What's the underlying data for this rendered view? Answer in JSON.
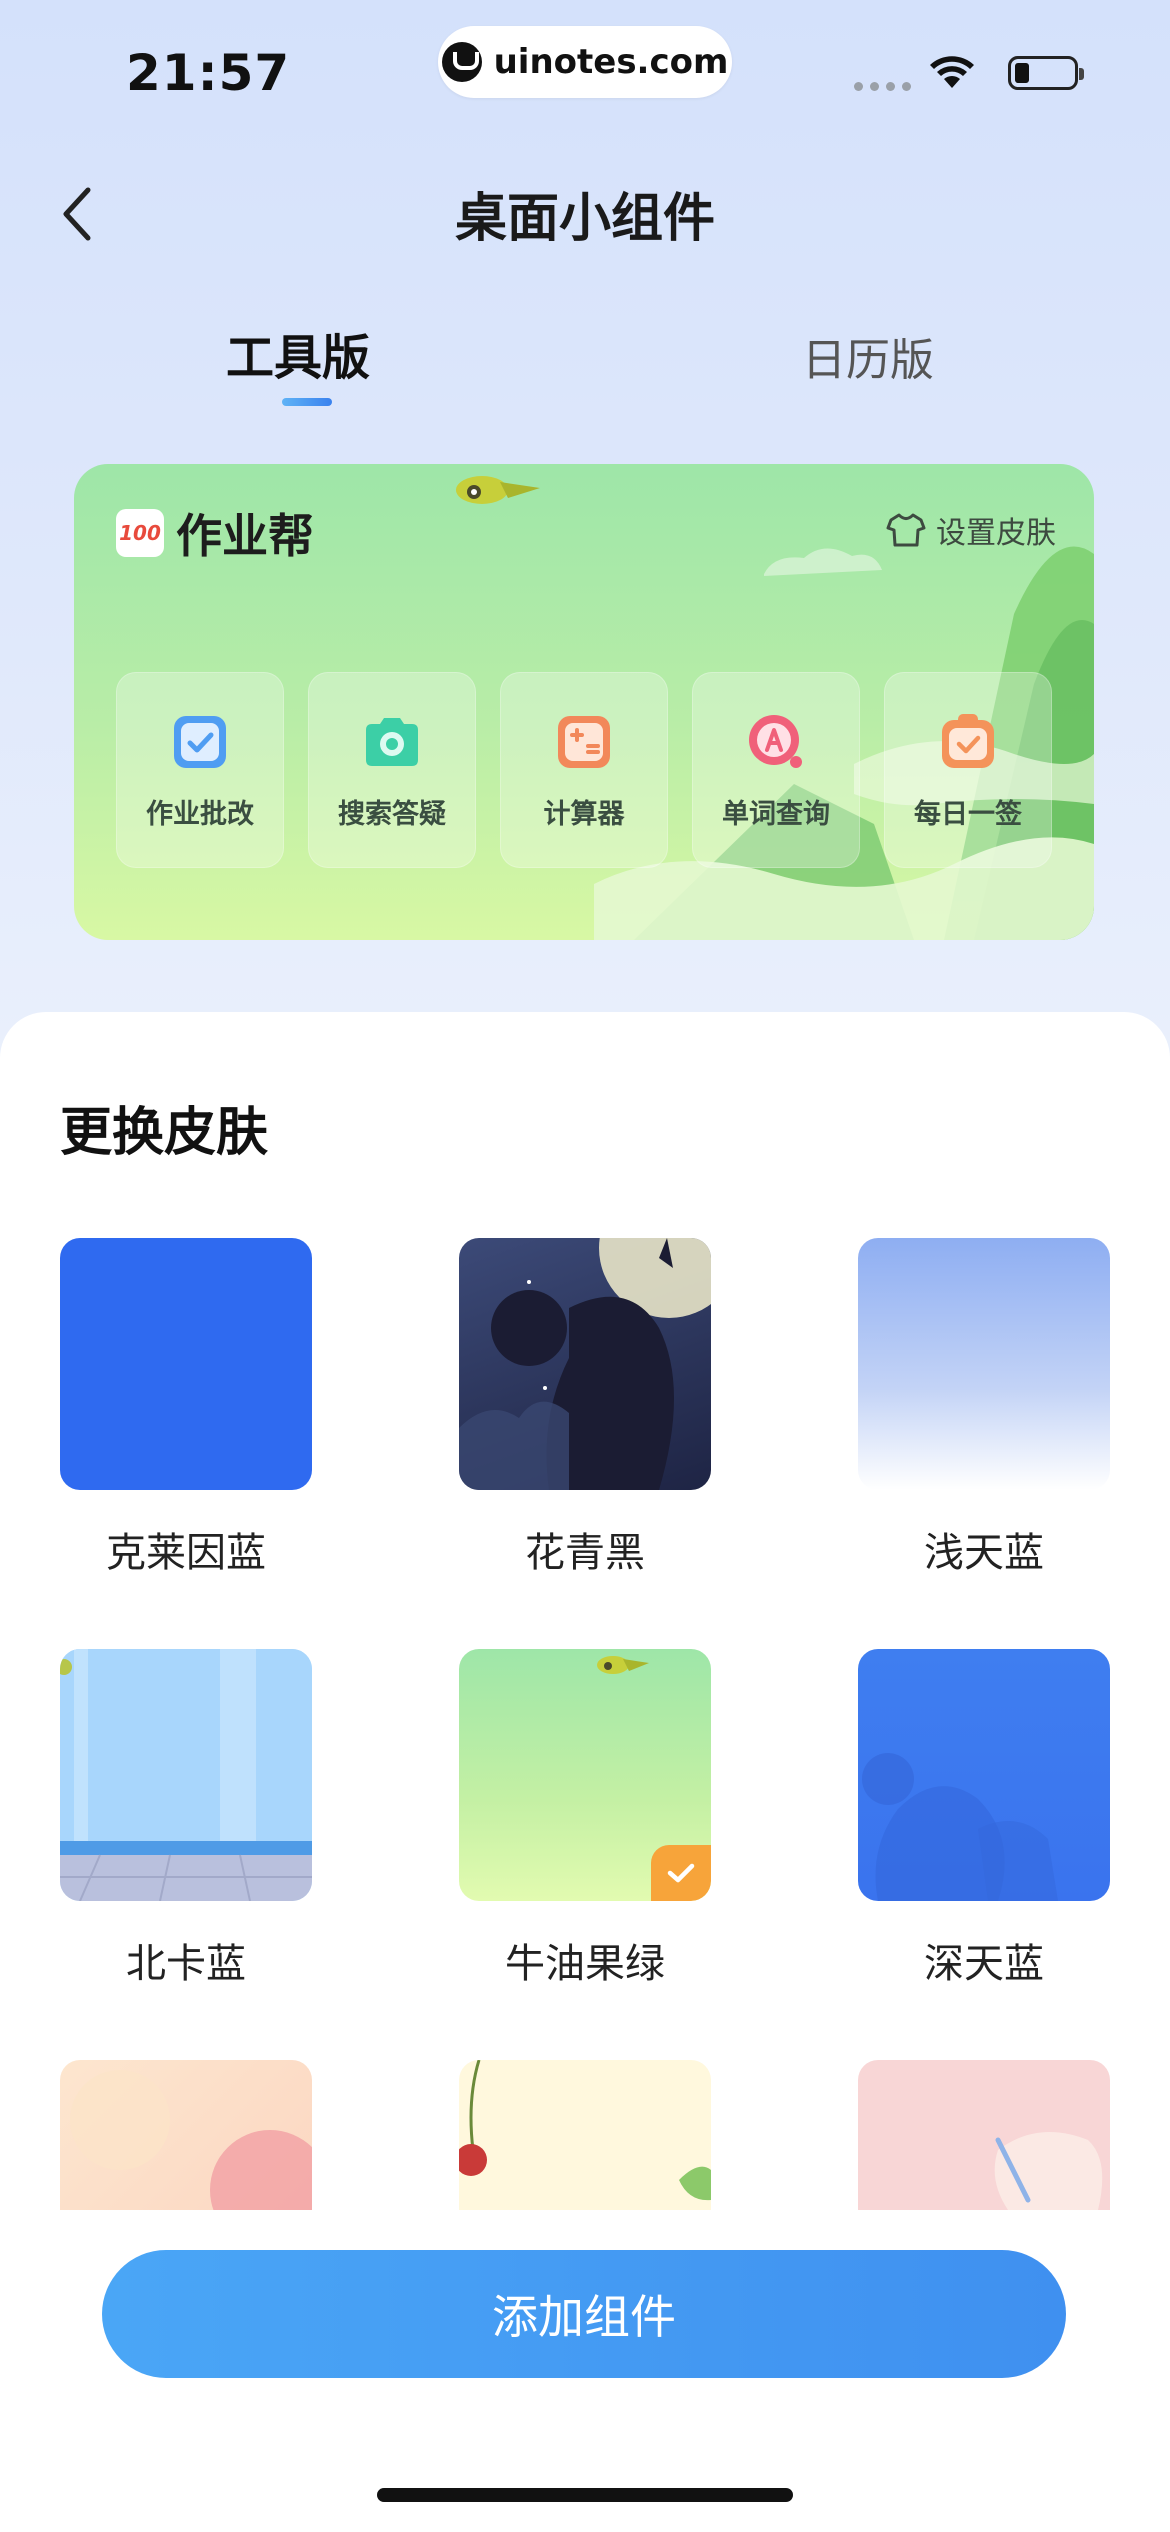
{
  "status_bar": {
    "time": "21:57",
    "url": "uinotes.com"
  },
  "nav": {
    "title": "桌面小组件",
    "back_icon": "chevron-left-icon"
  },
  "tabs": [
    {
      "label": "工具版",
      "active": true
    },
    {
      "label": "日历版",
      "active": false
    }
  ],
  "widget": {
    "logo_text": "100",
    "brand": "作业帮",
    "skin_setting": "设置皮肤",
    "tools": [
      {
        "label": "作业批改",
        "icon": "homework-check-icon",
        "color": "#4f9df2"
      },
      {
        "label": "搜索答疑",
        "icon": "camera-search-icon",
        "color": "#3ccfa6"
      },
      {
        "label": "计算器",
        "icon": "calculator-icon",
        "color": "#f2885a"
      },
      {
        "label": "单词查询",
        "icon": "word-lookup-icon",
        "color": "#f0607a"
      },
      {
        "label": "每日一签",
        "icon": "daily-sign-icon",
        "color": "#f4935a"
      }
    ]
  },
  "skins": {
    "title": "更换皮肤",
    "items": [
      {
        "label": "克莱因蓝",
        "selected": false
      },
      {
        "label": "花青黑",
        "selected": false
      },
      {
        "label": "浅天蓝",
        "selected": false
      },
      {
        "label": "北卡蓝",
        "selected": false
      },
      {
        "label": "牛油果绿",
        "selected": true
      },
      {
        "label": "深天蓝",
        "selected": false
      }
    ]
  },
  "add_button": "添加组件",
  "colors": {
    "accent": "#3f90f0",
    "selected_badge": "#f7a43a"
  }
}
